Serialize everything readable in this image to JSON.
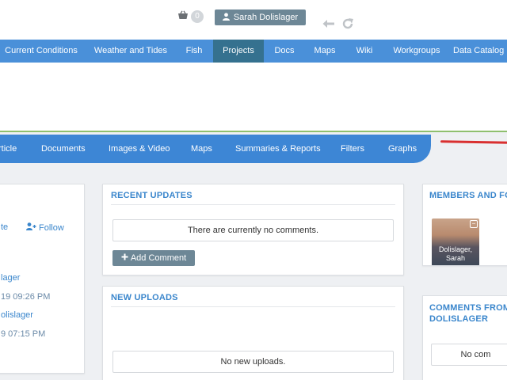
{
  "header": {
    "cart_count": "0",
    "user_name": "Sarah Dolislager"
  },
  "main_nav": {
    "items": [
      "Current Conditions",
      "Weather and Tides",
      "Fish",
      "Projects",
      "Docs",
      "Maps",
      "Wiki",
      "Workgroups",
      "Data Catalog"
    ],
    "active": "Projects"
  },
  "sub_nav": {
    "items": [
      "rticle",
      "Documents",
      "Images & Video",
      "Maps",
      "Summaries & Reports",
      "Filters",
      "Graphs"
    ]
  },
  "left_panel": {
    "action1": "te",
    "follow": "Follow",
    "name1": "lager",
    "date1": "19 09:26 PM",
    "name2": "olislager",
    "date2": "9 07:15 PM"
  },
  "recent_updates": {
    "title": "RECENT UPDATES",
    "message": "There are currently no comments.",
    "add_comment": "Add Comment"
  },
  "new_uploads": {
    "title": "NEW UPLOADS",
    "message": "No new uploads."
  },
  "members": {
    "title": "MEMBERS AND FO",
    "member_name_line1": "Dolislager,",
    "member_name_line2": "Sarah"
  },
  "comments_from": {
    "title_line1": "COMMENTS FROM",
    "title_line2": "DOLISLAGER",
    "message": "No com"
  },
  "colors": {
    "nav_blue": "#4a90d9",
    "nav_active": "#35718f",
    "subnav_blue": "#3d86d5",
    "accent_text": "#3a86cc",
    "button_gray": "#6d8796",
    "green_rule": "#8fbf6e",
    "red_mark": "#d93030"
  },
  "icons": [
    "basket-icon",
    "user-icon",
    "back-arrow-icon",
    "reload-icon",
    "follow-user-icon",
    "plus-icon",
    "minus-icon"
  ]
}
